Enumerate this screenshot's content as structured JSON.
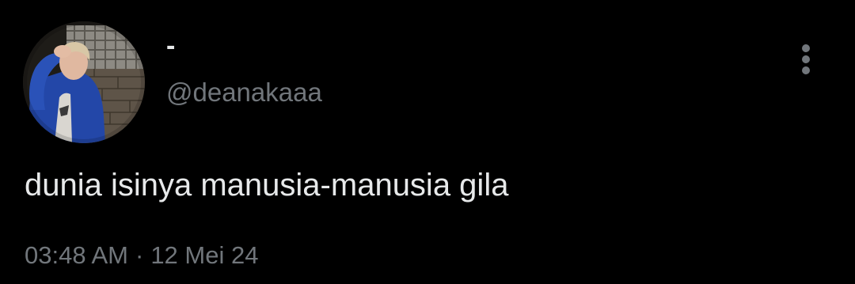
{
  "author": {
    "display_name": "-",
    "handle": "@deanakaaa",
    "avatar_icon": "profile-photo"
  },
  "tweet": {
    "text": "dunia isinya manusia-manusia gila",
    "time": "03:48 AM",
    "separator": "·",
    "date": "12 Mei 24"
  },
  "actions": {
    "more_icon": "more-vertical-icon"
  },
  "colors": {
    "background": "#000000",
    "primary_text": "#e7e9ea",
    "secondary_text": "#71767b",
    "jacket_blue": "#2347a8"
  }
}
